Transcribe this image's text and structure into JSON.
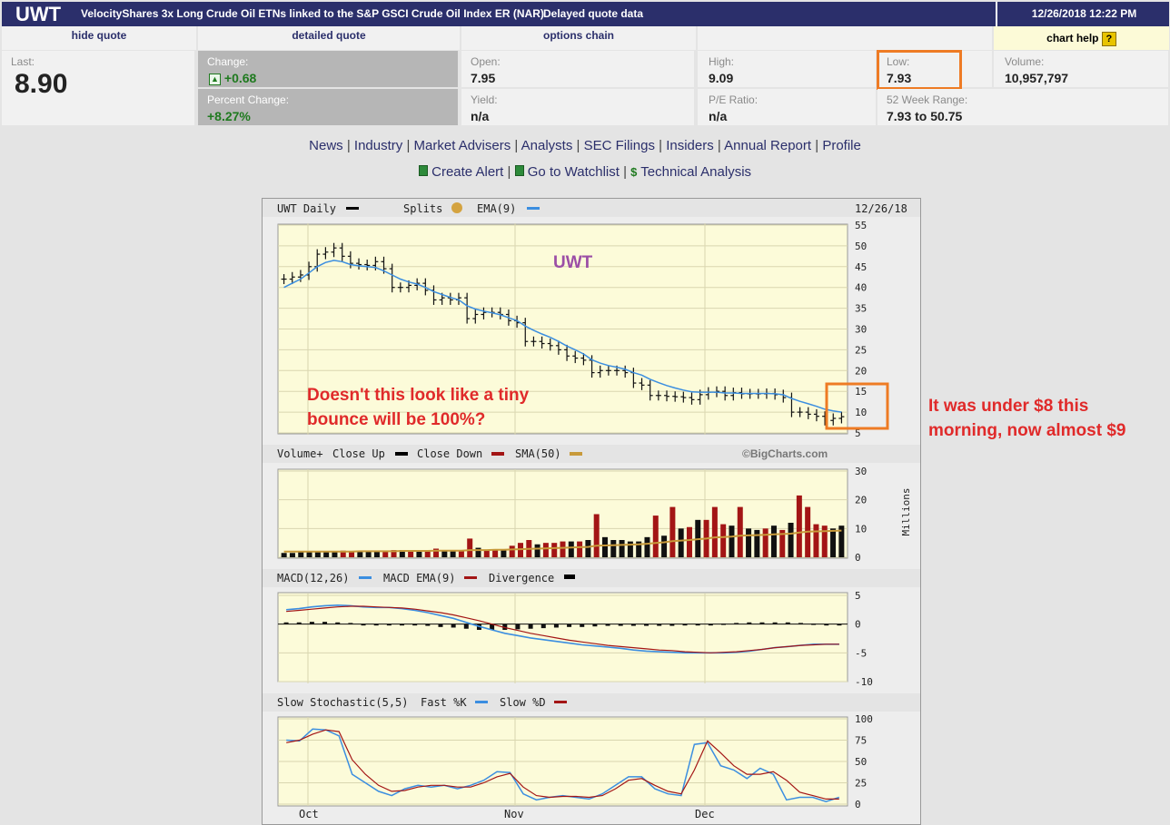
{
  "header": {
    "symbol": "UWT",
    "name": "VelocityShares 3x Long Crude Oil ETNs linked to the S&P GSCI Crude Oil Index ER (NAR)",
    "delayed": "Delayed quote data",
    "datetime": "12/26/2018 12:22 PM"
  },
  "nav": {
    "hide_quote": "hide quote",
    "detailed_quote": "detailed quote",
    "options_chain": "options chain",
    "chart_help": "chart help",
    "help_icon": "?"
  },
  "quote": {
    "last_label": "Last:",
    "last": "8.90",
    "change_label": "Change:",
    "change": "+0.68",
    "change_icon": "up-arrow-icon",
    "pct_label": "Percent Change:",
    "pct": "+8.27%",
    "open_label": "Open:",
    "open": "7.95",
    "yield_label": "Yield:",
    "yield": "n/a",
    "high_label": "High:",
    "high": "9.09",
    "pe_label": "P/E Ratio:",
    "pe": "n/a",
    "low_label": "Low:",
    "low": "7.93",
    "range_label": "52 Week Range:",
    "range": "7.93 to 50.75",
    "volume_label": "Volume:",
    "volume": "10,957,797"
  },
  "links1": [
    "News",
    "Industry",
    "Market Advisers",
    "Analysts",
    "SEC Filings",
    "Insiders",
    "Annual Report",
    "Profile"
  ],
  "links2": [
    "Create Alert",
    "Go to Watchlist",
    "Technical Analysis"
  ],
  "links2_icons": [
    "sheet-icon",
    "sheet-icon",
    "dollar-icon"
  ],
  "chart": {
    "price_header": "UWT Daily",
    "splits": "Splits",
    "ema_label": "EMA(9)",
    "date": "12/26/18",
    "price_title": "UWT",
    "volume_header": [
      "Volume+",
      "Close Up",
      "Close Down",
      "SMA(50)"
    ],
    "copyright": "©BigCharts.com",
    "volume_units": "Millions",
    "macd_header": [
      "MACD(12,26)",
      "MACD EMA(9)",
      "Divergence"
    ],
    "stoch_header": [
      "Slow Stochastic(5,5)",
      "Fast %K",
      "Slow %D"
    ],
    "months": [
      "Oct",
      "Nov",
      "Dec"
    ],
    "colors": {
      "panel_bg": "#fcfbd9",
      "ema": "#3b8ee0",
      "down": "#a31515",
      "sma": "#c89a3a",
      "annot": "#e8782e"
    }
  },
  "annotations": {
    "left": [
      "Doesn't this look like a tiny",
      "bounce will be 100%?"
    ],
    "right": [
      "It was under $8 this",
      "morning, now almost $9"
    ]
  },
  "chart_data": [
    {
      "type": "bar",
      "title": "UWT Daily",
      "ylim": [
        5,
        55
      ],
      "yticks": [
        5,
        10,
        15,
        20,
        25,
        30,
        35,
        40,
        45,
        50,
        55
      ],
      "close": [
        42,
        42.5,
        43,
        45,
        48,
        48.5,
        49.5,
        47.5,
        45.8,
        45.5,
        45.3,
        46.2,
        44.5,
        40,
        40,
        40.5,
        41,
        39.3,
        37,
        37.5,
        37,
        37.5,
        32.5,
        33.5,
        34,
        34,
        33.5,
        32,
        31.5,
        27,
        27,
        26.5,
        26,
        25,
        23.5,
        23,
        22.5,
        19.5,
        20,
        20,
        20,
        19.5,
        17,
        16.5,
        14,
        14,
        13.8,
        13.7,
        13.5,
        13,
        14.2,
        14.8,
        15,
        14,
        14.7,
        14.4,
        14.4,
        14.4,
        14.5,
        14.2,
        13.5,
        10,
        10,
        9.5,
        9,
        8,
        8.5,
        8.9
      ],
      "ema": [
        40,
        41,
        42,
        43.5,
        45,
        46,
        46.5,
        46.2,
        45.5,
        45.2,
        45,
        44.8,
        44,
        43,
        42,
        41.3,
        40.8,
        40,
        39,
        38.3,
        37.6,
        37,
        35.6,
        34.8,
        34.3,
        33.9,
        33.4,
        32.7,
        32,
        30.7,
        29.7,
        28.8,
        28,
        27,
        25.9,
        25,
        24,
        22.6,
        21.8,
        21.2,
        20.8,
        20.3,
        19.5,
        18.9,
        17.9,
        17.1,
        16.4,
        15.8,
        15.3,
        14.9,
        14.8,
        14.8,
        14.8,
        14.6,
        14.6,
        14.5,
        14.5,
        14.5,
        14.5,
        14.4,
        14.2,
        13.3,
        12.6,
        12,
        11.4,
        10.7,
        10.3,
        10
      ]
    },
    {
      "type": "bar",
      "title": "Volume+",
      "ylabel": "Millions",
      "ylim": [
        0,
        30
      ],
      "yticks": [
        0,
        10,
        20,
        30
      ],
      "values": [
        1.5,
        1.5,
        2,
        1.8,
        2,
        1.8,
        2,
        2.3,
        2,
        2.2,
        2.2,
        2.3,
        2,
        2.5,
        2.5,
        2.5,
        2.3,
        2.3,
        3,
        2.5,
        2.3,
        2.5,
        6.5,
        3.3,
        2.5,
        2.7,
        2.5,
        4,
        5,
        6,
        4.5,
        5,
        5,
        5.5,
        5.5,
        5.5,
        6,
        15,
        7,
        6,
        6,
        5.5,
        5.5,
        7,
        14.5,
        7.5,
        17.5,
        10,
        10.5,
        13,
        13,
        17.5,
        11.5,
        11,
        17.5,
        10,
        9.5,
        10,
        11,
        9.5,
        12,
        21.5,
        17.5,
        11.5,
        11,
        10,
        11
      ],
      "sma": [
        2,
        2,
        2,
        2,
        2,
        2,
        2,
        2,
        2,
        2.1,
        2.1,
        2.1,
        2.1,
        2.1,
        2.2,
        2.2,
        2.2,
        2.2,
        2.3,
        2.3,
        2.3,
        2.3,
        2.5,
        2.5,
        2.5,
        2.6,
        2.6,
        2.7,
        2.8,
        2.9,
        3,
        3.1,
        3.2,
        3.3,
        3.4,
        3.5,
        3.6,
        4,
        4.1,
        4.2,
        4.3,
        4.4,
        4.5,
        4.7,
        5,
        5.2,
        5.6,
        5.8,
        6,
        6.3,
        6.5,
        6.9,
        7,
        7.2,
        7.5,
        7.6,
        7.7,
        7.8,
        8,
        8.1,
        8.2,
        8.6,
        8.9,
        9,
        9.1,
        9.2,
        9.3
      ]
    },
    {
      "type": "line",
      "title": "MACD(12,26)",
      "ylim": [
        -10,
        5
      ],
      "yticks": [
        5,
        0,
        -5,
        -10
      ],
      "macd": [
        2.5,
        2.7,
        3,
        3.2,
        3.3,
        3.2,
        3,
        2.9,
        2.9,
        2.7,
        2.4,
        2,
        1.5,
        1,
        0.3,
        -0.4,
        -1,
        -1.6,
        -2,
        -2.4,
        -2.7,
        -3,
        -3.3,
        -3.6,
        -3.8,
        -4,
        -4.2,
        -4.5,
        -4.7,
        -4.8,
        -4.9,
        -5,
        -5,
        -5,
        -5,
        -4.9,
        -4.7,
        -4.4,
        -4.1,
        -3.9,
        -3.7,
        -3.5,
        -3.5,
        -3.5
      ],
      "signal": [
        2.2,
        2.4,
        2.6,
        2.8,
        3,
        3.1,
        3.1,
        3,
        2.9,
        2.8,
        2.6,
        2.3,
        2,
        1.6,
        1.1,
        0.6,
        0,
        -0.6,
        -1.1,
        -1.6,
        -2,
        -2.4,
        -2.8,
        -3.1,
        -3.4,
        -3.7,
        -3.9,
        -4.1,
        -4.3,
        -4.5,
        -4.6,
        -4.8,
        -4.9,
        -5,
        -4.9,
        -4.8,
        -4.6,
        -4.4,
        -4.1,
        -3.9,
        -3.7,
        -3.6,
        -3.5,
        -3.5
      ],
      "divergence": [
        0.3,
        0.3,
        0.4,
        0.4,
        0.3,
        0.2,
        0,
        -0.1,
        0,
        -0.1,
        -0.2,
        -0.3,
        -0.5,
        -0.6,
        -0.8,
        -1,
        -1,
        -1,
        -0.9,
        -0.8,
        -0.7,
        -0.6,
        -0.5,
        -0.5,
        -0.4,
        -0.3,
        -0.3,
        -0.3,
        -0.3,
        -0.3,
        -0.3,
        -0.2,
        -0.1,
        0,
        0.1,
        0.2,
        0.3,
        0.3,
        0.3,
        0.3,
        0.2,
        0.1,
        0,
        0
      ]
    },
    {
      "type": "line",
      "title": "Slow Stochastic(5,5)",
      "ylim": [
        0,
        100
      ],
      "yticks": [
        100,
        75,
        50,
        25,
        0
      ],
      "fast_k": [
        75,
        74,
        88,
        87,
        80,
        35,
        25,
        15,
        10,
        18,
        22,
        20,
        22,
        18,
        22,
        28,
        38,
        37,
        12,
        5,
        8,
        10,
        8,
        6,
        12,
        22,
        32,
        32,
        18,
        12,
        10,
        70,
        72,
        45,
        40,
        30,
        42,
        35,
        5,
        8,
        8,
        3,
        8
      ],
      "slow_d": [
        72,
        75,
        82,
        87,
        85,
        52,
        35,
        22,
        15,
        16,
        20,
        22,
        22,
        20,
        20,
        25,
        32,
        36,
        20,
        10,
        8,
        9,
        9,
        8,
        10,
        18,
        28,
        30,
        22,
        15,
        12,
        40,
        74,
        60,
        45,
        35,
        35,
        38,
        28,
        14,
        10,
        6,
        6
      ]
    }
  ]
}
